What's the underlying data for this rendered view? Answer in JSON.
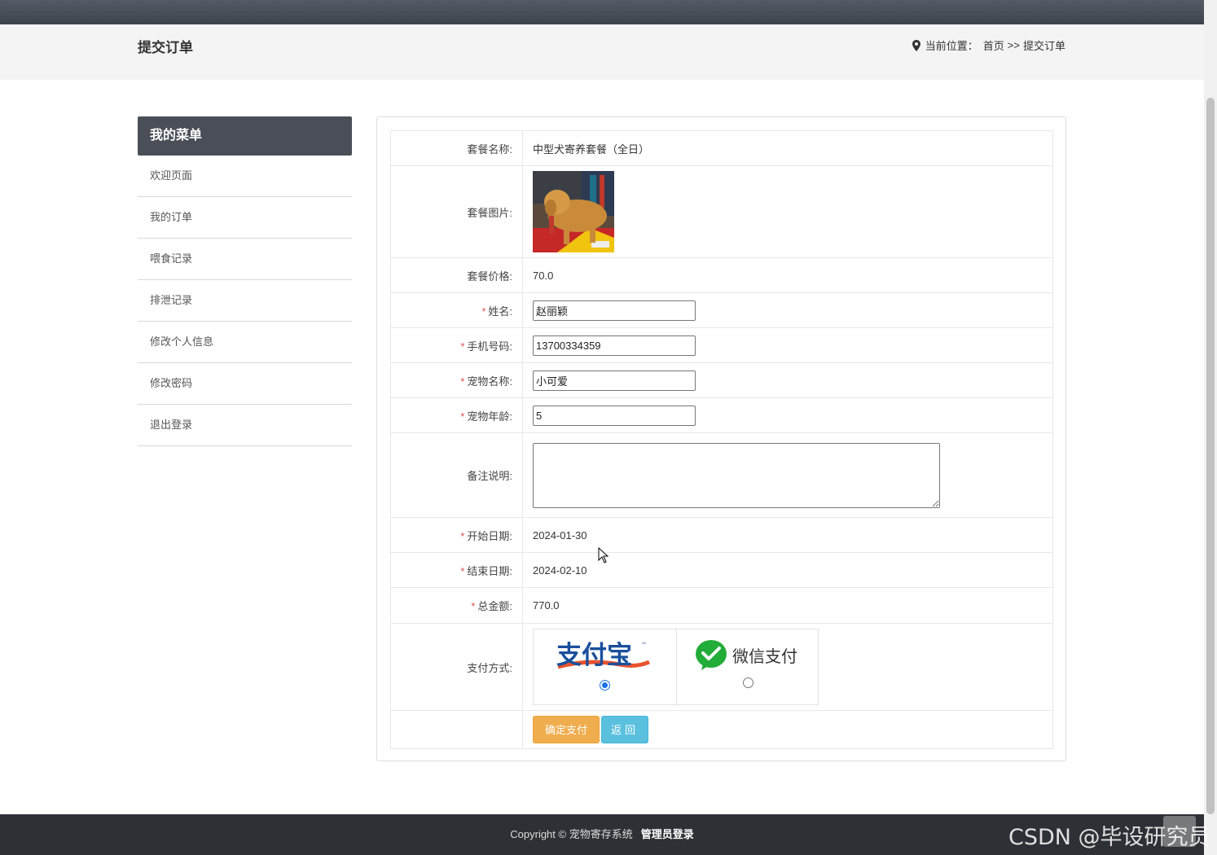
{
  "header": {
    "page_title": "提交订单",
    "breadcrumb_prefix": "当前位置：",
    "breadcrumb_home": "首页",
    "breadcrumb_sep": ">>",
    "breadcrumb_current": "提交订单"
  },
  "sidebar": {
    "title": "我的菜单",
    "items": [
      {
        "label": "欢迎页面"
      },
      {
        "label": "我的订单"
      },
      {
        "label": "喂食记录"
      },
      {
        "label": "排泄记录"
      },
      {
        "label": "修改个人信息"
      },
      {
        "label": "修改密码"
      },
      {
        "label": "退出登录"
      }
    ]
  },
  "order": {
    "package_name_label": "套餐名称:",
    "package_name": "中型犬寄养套餐（全日）",
    "package_image_label": "套餐图片:",
    "package_price_label": "套餐价格:",
    "package_price": "70.0",
    "name_label": "姓名:",
    "name_value": "赵丽颖",
    "phone_label": "手机号码:",
    "phone_value": "13700334359",
    "pet_name_label": "宠物名称:",
    "pet_name_value": "小可爱",
    "pet_age_label": "宠物年龄:",
    "pet_age_value": "5",
    "remark_label": "备注说明:",
    "remark_value": "",
    "start_date_label": "开始日期:",
    "start_date": "2024-01-30",
    "end_date_label": "结束日期:",
    "end_date": "2024-02-10",
    "total_label": "总金额:",
    "total": "770.0",
    "payment_label": "支付方式:",
    "alipay_logo": "支付宝",
    "wechat_logo": "微信支付",
    "selected_payment": "alipay",
    "required_mark": "*"
  },
  "actions": {
    "confirm_label": "确定支付",
    "back_label": "返回"
  },
  "footer": {
    "copyright": "Copyright © 宠物寄存系统",
    "admin_login": "管理员登录"
  },
  "watermark": "CSDN @毕设研究员",
  "colors": {
    "sidebar_head": "#4a4f57",
    "confirm_button": "#f0ad4e",
    "back_button": "#5bc0de",
    "total_price": "#d9534f",
    "footer_bg": "#2d3035"
  }
}
